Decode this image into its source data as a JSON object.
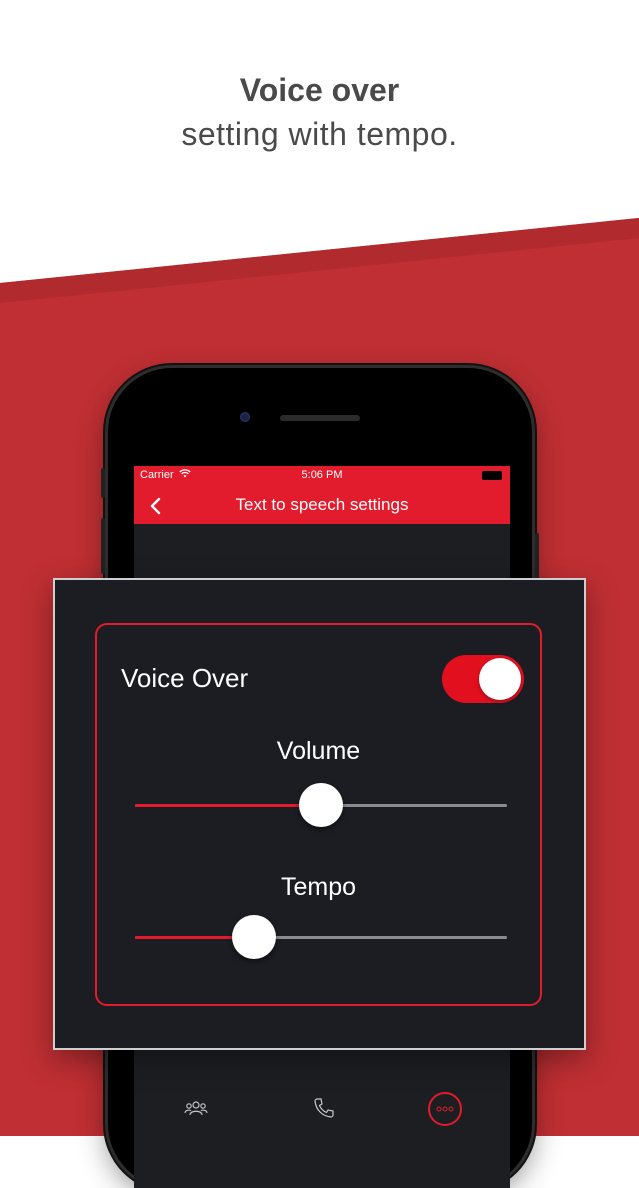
{
  "headline": {
    "bold": "Voice over",
    "light": "setting with tempo."
  },
  "statusbar": {
    "carrier": "Carrier",
    "time": "5:06 PM"
  },
  "navbar": {
    "title": "Text to speech settings",
    "back_icon": "chevron-left-icon"
  },
  "settings": {
    "voice_over": {
      "label": "Voice Over",
      "enabled": true
    },
    "volume": {
      "label": "Volume",
      "value": 0.5
    },
    "tempo": {
      "label": "Tempo",
      "value": 0.32
    }
  },
  "tabbar": {
    "icons": [
      "group-icon",
      "phone-icon",
      "more-icon"
    ],
    "active": "more-icon"
  },
  "colors": {
    "accent": "#e21b2d",
    "background_red": "#bf2f33",
    "card": "#1c1d22"
  }
}
